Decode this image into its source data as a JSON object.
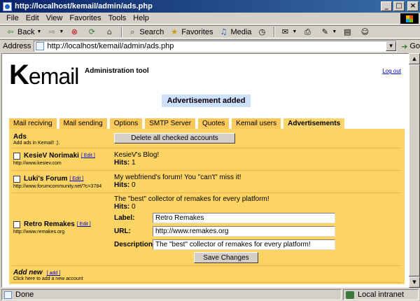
{
  "window": {
    "title": "http://localhost/kemail/admin/ads.php"
  },
  "menu": [
    "File",
    "Edit",
    "View",
    "Favorites",
    "Tools",
    "Help"
  ],
  "toolbar": {
    "back": "Back",
    "search": "Search",
    "favorites": "Favorites",
    "media": "Media"
  },
  "address": {
    "label": "Address",
    "url": "http://localhost/kemail/admin/ads.php",
    "go": "Go"
  },
  "header": {
    "logo_k": "K",
    "logo_rest": "email",
    "subtitle": "Administration tool",
    "logout": "Log out"
  },
  "notice": "Advertisement added",
  "tabs": [
    {
      "label": "Mail reciving",
      "active": false
    },
    {
      "label": "Mail sending",
      "active": false
    },
    {
      "label": "Options",
      "active": false
    },
    {
      "label": "SMTP Server",
      "active": false
    },
    {
      "label": "Quotes",
      "active": false
    },
    {
      "label": "Kemail users",
      "active": false
    },
    {
      "label": "Advertisements",
      "active": true
    }
  ],
  "ads": {
    "title": "Ads",
    "subtitle": "Add ads in Kemail! ;).",
    "delete_button": "Delete all checked accounts",
    "edit_label": "[ Edit ]",
    "hits_label": "Hits:",
    "entries": [
      {
        "name": "KesieV Norimaki",
        "url": "http://www.kesiev.com",
        "description": "KesieV's Blog!",
        "hits": "1"
      },
      {
        "name": "Luki's Forum",
        "url": "http://www.forumcommunity.net/?c=3784",
        "description": "My webfriend's forum! You \"can't\" miss it!",
        "hits": "0"
      },
      {
        "name": "Retro Remakes",
        "url": "http://www.remakes.org",
        "description": "The \"best\" collector of remakes for every platform!",
        "hits": "0"
      }
    ],
    "edit_form": {
      "label_label": "Label:",
      "label_value": "Retro Remakes",
      "url_label": "URL:",
      "url_value": "http://www.remakes.org",
      "description_label": "Description:",
      "description_value": "The \"best\" collector of remakes for every platform!",
      "save_button": "Save Changes"
    },
    "add_new": {
      "title": "Add new",
      "link": "[ add ]",
      "subtitle": "Click here to add a new account"
    }
  },
  "status": {
    "text": "Done",
    "zone": "Local intranet"
  }
}
